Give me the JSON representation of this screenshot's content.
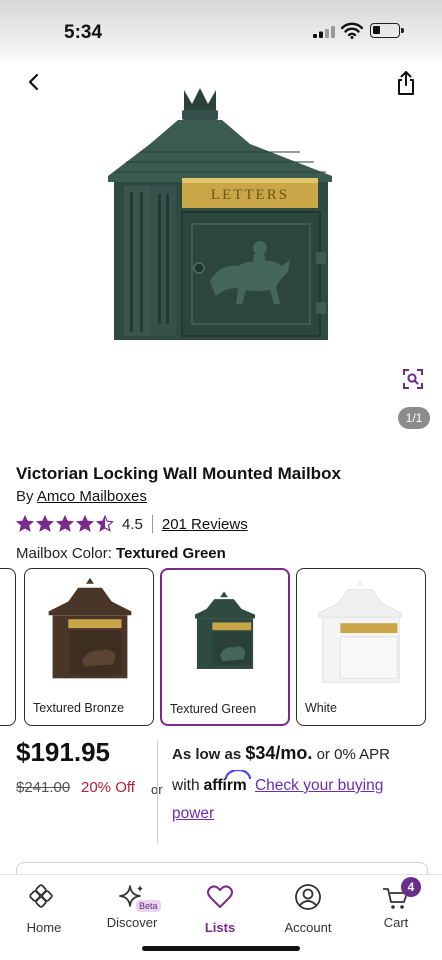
{
  "status_bar": {
    "time": "5:34"
  },
  "product": {
    "title": "Victorian Locking Wall Mounted Mailbox",
    "brand_prefix": "By",
    "brand": "Amco Mailboxes",
    "rating": "4.5",
    "stars_value": 4.5,
    "reviews_label": "201 Reviews",
    "image_counter": "1/1",
    "image_plate_text": "LETTERS"
  },
  "options": {
    "color_label": "Mailbox Color:",
    "selected_color": "Textured Green",
    "swatches": [
      {
        "label": "Textured Bronze",
        "color": "#4a3628"
      },
      {
        "label": "Textured Green",
        "color": "#2f4a40"
      },
      {
        "label": "White",
        "color": "#f4f4f4"
      }
    ]
  },
  "pricing": {
    "price": "$191.95",
    "original_price": "$241.00",
    "discount": "20% Off",
    "or": "or",
    "as_low_as": "As low as",
    "monthly": "$34/mo.",
    "apr": "or 0% APR",
    "with": "with",
    "affirm": "affirm",
    "check_link": "Check your buying power"
  },
  "tab_bar": {
    "items": [
      {
        "label": "Home",
        "icon": "home-icon"
      },
      {
        "label": "Discover",
        "icon": "sparkle-icon",
        "badge": "Beta"
      },
      {
        "label": "Lists",
        "icon": "heart-icon",
        "active": true
      },
      {
        "label": "Account",
        "icon": "account-icon"
      },
      {
        "label": "Cart",
        "icon": "cart-icon",
        "badge": "4"
      }
    ]
  },
  "colors": {
    "accent_purple": "#7a2a8a",
    "star_purple": "#7b2b8c",
    "discount_red": "#b32033",
    "link_purple": "#6a2db8",
    "mailbox_green": "#2f4a40",
    "brass": "#c9a648"
  }
}
